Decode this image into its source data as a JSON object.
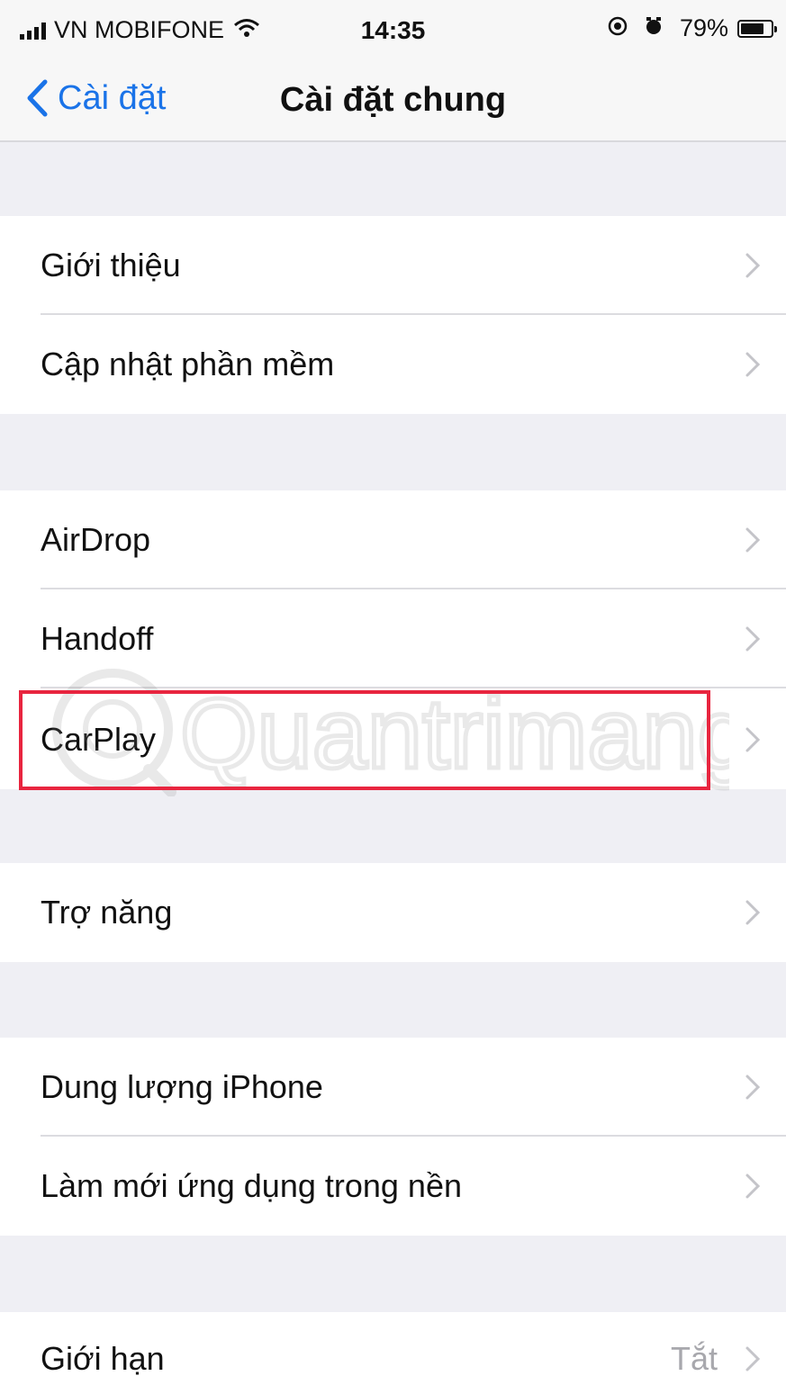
{
  "status_bar": {
    "carrier": "VN MOBIFONE",
    "time": "14:35",
    "battery": "79%",
    "battery_level": 0.79
  },
  "nav": {
    "back_label": "Cài đặt",
    "title": "Cài đặt chung"
  },
  "rows": [
    {
      "label": "Giới thiệu"
    },
    {
      "label": "Cập nhật phần mềm"
    },
    {
      "label": "AirDrop"
    },
    {
      "label": "Handoff"
    },
    {
      "label": "CarPlay",
      "highlighted": true
    },
    {
      "label": "Trợ năng"
    },
    {
      "label": "Dung lượng iPhone"
    },
    {
      "label": "Làm mới ứng dụng trong nền"
    },
    {
      "label": "Giới hạn",
      "value": "Tắt"
    }
  ],
  "watermark": "Quantrimang",
  "colors": {
    "accent": "#1a73e8",
    "highlight": "#e8253f",
    "group_background": "#efeff4",
    "separator": "#dcdce0"
  },
  "icons": [
    "cellular-signal-icon",
    "wifi-icon",
    "location-icon",
    "alarm-icon",
    "battery-icon",
    "back-chevron-icon",
    "chevron-right-icon"
  ]
}
